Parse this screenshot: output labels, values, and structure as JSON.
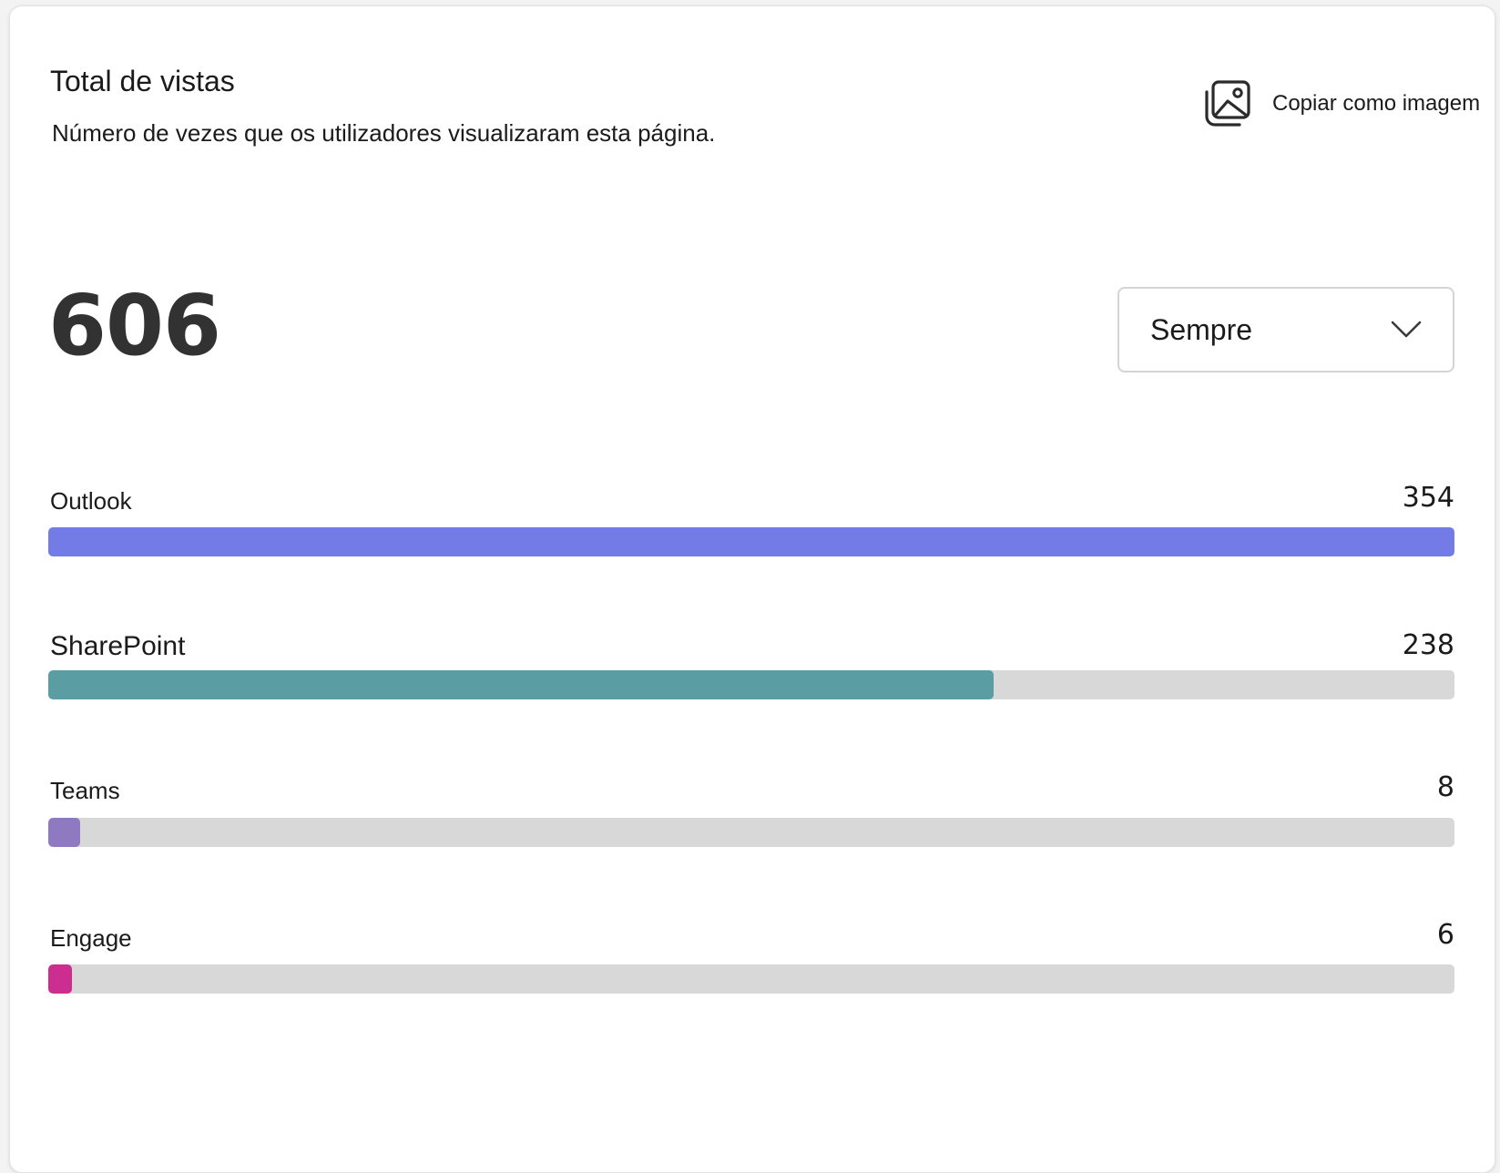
{
  "header": {
    "title": "Total de vistas",
    "subtitle": "Número de vezes que os utilizadores visualizaram esta página.",
    "copy_label": "Copiar como imagem",
    "copy_icon": "image-copy-icon"
  },
  "summary": {
    "total": "606",
    "period_select": {
      "selected": "Sempre",
      "icon": "chevron-down-icon"
    }
  },
  "chart_data": {
    "type": "bar",
    "orientation": "horizontal",
    "categories": [
      "Outlook",
      "SharePoint",
      "Teams",
      "Engage"
    ],
    "values": [
      354,
      238,
      8,
      6
    ],
    "max": 354,
    "colors": [
      "#737ce6",
      "#5a9da3",
      "#8f79c0",
      "#cb2e8f"
    ],
    "track_color": "#d8d8d8"
  },
  "rows": [
    {
      "label": "Outlook",
      "value": "354"
    },
    {
      "label": "SharePoint",
      "value": "238"
    },
    {
      "label": "Teams",
      "value": "8"
    },
    {
      "label": "Engage",
      "value": "6"
    }
  ]
}
